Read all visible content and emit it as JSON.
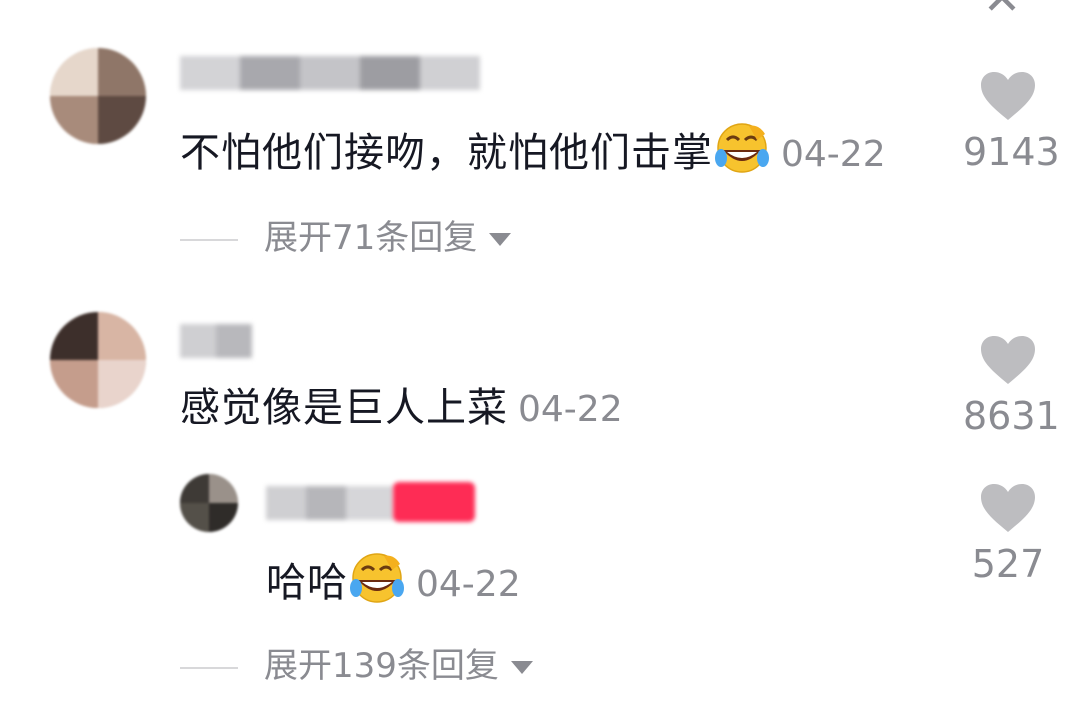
{
  "comments": [
    {
      "text": "不怕他们接吻，就怕他们击掌",
      "emoji": "rofl-emoji",
      "date": "04-22",
      "likes": "9143",
      "expand_replies": "展开71条回复"
    },
    {
      "text": "感觉像是巨人上菜",
      "date": "04-22",
      "likes": "8631",
      "reply": {
        "text": "哈哈",
        "emoji": "rofl-emoji",
        "date": "04-22",
        "likes": "527"
      },
      "expand_replies": "展开139条回复"
    }
  ],
  "icons": {
    "close": "close-icon",
    "like": "heart-icon",
    "expand": "triangle-down-icon"
  },
  "colors": {
    "text": "#161823",
    "secondary": "#8a8b91",
    "heart": "#bdbdc0",
    "badge": "#fe2c55"
  }
}
